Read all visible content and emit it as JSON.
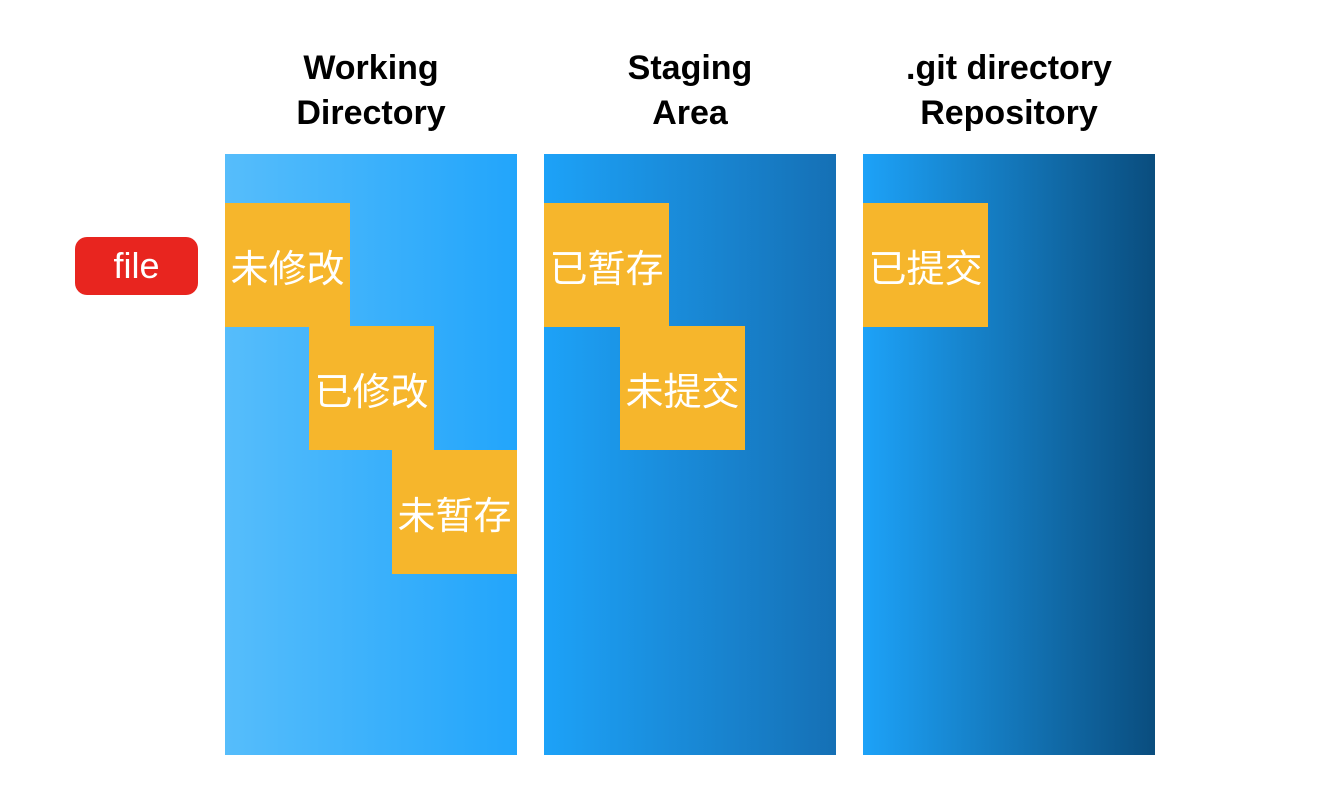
{
  "columns": [
    {
      "title_line1": "Working",
      "title_line2": "Directory",
      "states": [
        "未修改",
        "已修改",
        "未暂存"
      ]
    },
    {
      "title_line1": "Staging",
      "title_line2": "Area",
      "states": [
        "已暂存",
        "未提交"
      ]
    },
    {
      "title_line1": ".git directory",
      "title_line2": "Repository",
      "states": [
        "已提交"
      ]
    }
  ],
  "file_badge": "file",
  "colors": {
    "state_box": "#f6b62c",
    "file_badge": "#e8251f",
    "column_light": "#56bdfb",
    "column_dark": "#0a4d7e"
  }
}
